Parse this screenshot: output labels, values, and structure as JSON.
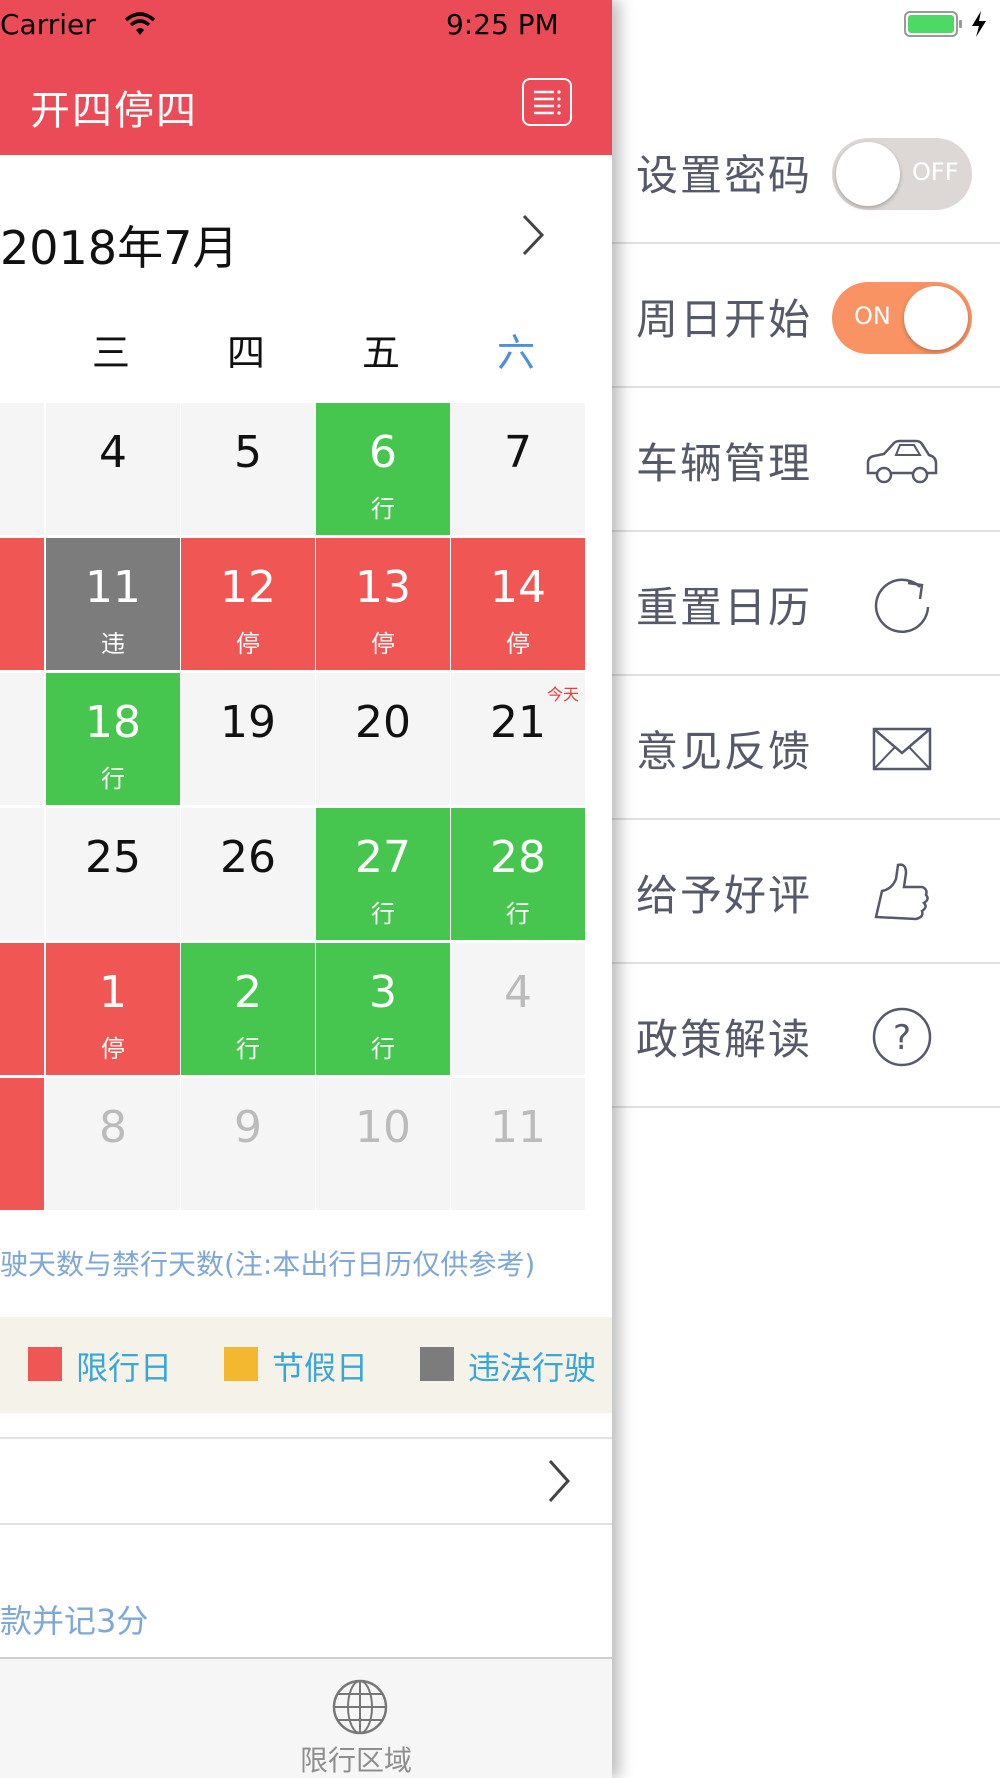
{
  "status_bar": {
    "carrier": "Carrier",
    "time": "9:25 PM",
    "icons": [
      "wifi-icon",
      "battery-icon",
      "charging-bolt-icon"
    ]
  },
  "nav": {
    "title": "开四停四",
    "menu_icon": "list-icon"
  },
  "calendar": {
    "month_title": "2018年7月",
    "next_icon": "chevron-right-icon",
    "weekdays": [
      "三",
      "四",
      "五",
      "六"
    ],
    "today_label": "今天",
    "rows": [
      [
        {
          "day": "",
          "kind": "normal",
          "tag": ""
        },
        {
          "day": "4",
          "kind": "normal",
          "tag": ""
        },
        {
          "day": "5",
          "kind": "normal",
          "tag": ""
        },
        {
          "day": "6",
          "kind": "green",
          "tag": "行"
        },
        {
          "day": "7",
          "kind": "normal",
          "tag": ""
        }
      ],
      [
        {
          "day": "",
          "kind": "red",
          "tag": ""
        },
        {
          "day": "11",
          "kind": "gray",
          "tag": "违"
        },
        {
          "day": "12",
          "kind": "red",
          "tag": "停"
        },
        {
          "day": "13",
          "kind": "red",
          "tag": "停"
        },
        {
          "day": "14",
          "kind": "red",
          "tag": "停"
        }
      ],
      [
        {
          "day": "",
          "kind": "normal",
          "tag": ""
        },
        {
          "day": "18",
          "kind": "green",
          "tag": "行"
        },
        {
          "day": "19",
          "kind": "normal",
          "tag": ""
        },
        {
          "day": "20",
          "kind": "normal",
          "tag": ""
        },
        {
          "day": "21",
          "kind": "normal",
          "tag": "",
          "today": true
        }
      ],
      [
        {
          "day": "",
          "kind": "normal",
          "tag": ""
        },
        {
          "day": "25",
          "kind": "normal",
          "tag": ""
        },
        {
          "day": "26",
          "kind": "normal",
          "tag": ""
        },
        {
          "day": "27",
          "kind": "green",
          "tag": "行"
        },
        {
          "day": "28",
          "kind": "green",
          "tag": "行"
        }
      ],
      [
        {
          "day": "",
          "kind": "red",
          "tag": ""
        },
        {
          "day": "1",
          "kind": "red",
          "tag": "停"
        },
        {
          "day": "2",
          "kind": "green",
          "tag": "行"
        },
        {
          "day": "3",
          "kind": "green",
          "tag": "行"
        },
        {
          "day": "4",
          "kind": "faded",
          "tag": ""
        }
      ],
      [
        {
          "day": "",
          "kind": "red",
          "tag": ""
        },
        {
          "day": "8",
          "kind": "faded",
          "tag": ""
        },
        {
          "day": "9",
          "kind": "faded",
          "tag": ""
        },
        {
          "day": "10",
          "kind": "faded",
          "tag": ""
        },
        {
          "day": "11",
          "kind": "faded",
          "tag": ""
        }
      ]
    ]
  },
  "note": "驶天数与禁行天数(注:本出行日历仅供参考)",
  "legend": [
    {
      "label": "限行日",
      "color": "#f05654"
    },
    {
      "label": "节假日",
      "color": "#f3b730"
    },
    {
      "label": "违法行驶",
      "color": "#7c7c7c"
    }
  ],
  "entry_row": {
    "chevron_icon": "chevron-right-icon"
  },
  "rule_text": "款并记3分",
  "tab_bar": {
    "label": "限行区域",
    "icon": "globe-icon"
  },
  "menu": {
    "items": [
      {
        "label": "设置密码",
        "control": "toggle",
        "on": false,
        "state_text": "OFF"
      },
      {
        "label": "周日开始",
        "control": "toggle",
        "on": true,
        "state_text": "ON"
      },
      {
        "label": "车辆管理",
        "icon": "car-icon"
      },
      {
        "label": "重置日历",
        "icon": "refresh-icon"
      },
      {
        "label": "意见反馈",
        "icon": "envelope-icon"
      },
      {
        "label": "给予好评",
        "icon": "thumbs-up-icon"
      },
      {
        "label": "政策解读",
        "icon": "question-circle-icon"
      }
    ]
  },
  "colors": {
    "nav_red": "#ea4b57",
    "green": "#46c64e",
    "red": "#f05654",
    "gray": "#7c7c7c",
    "toggle_on": "#f99363",
    "toggle_off": "#ddd8d5",
    "link_blue": "#7fa8d6",
    "legend_text": "#3aa6d8"
  }
}
